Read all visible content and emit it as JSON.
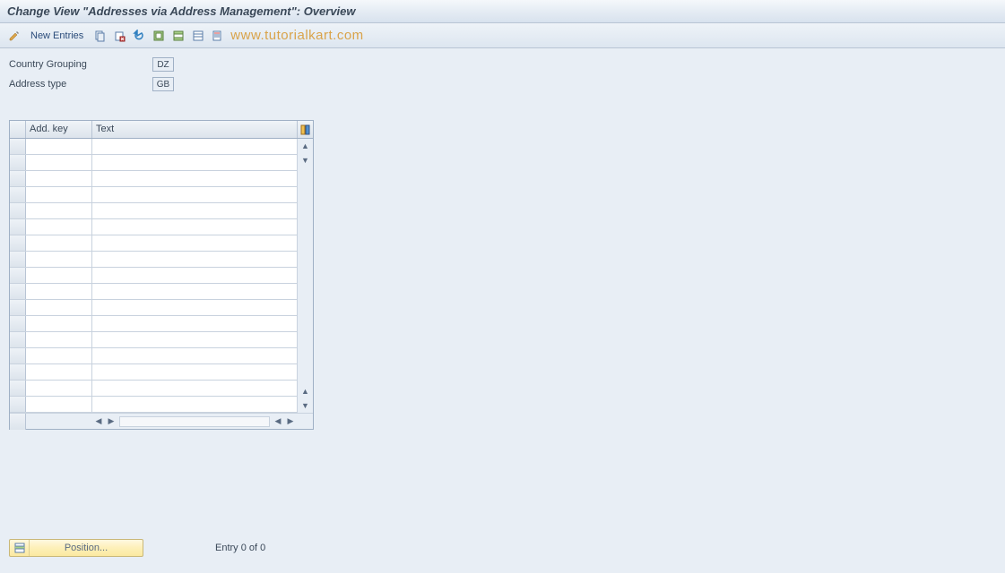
{
  "title": "Change View \"Addresses via Address Management\": Overview",
  "toolbar": {
    "new_entries_label": "New Entries"
  },
  "watermark": "www.tutorialkart.com",
  "fields": {
    "country_grouping": {
      "label": "Country Grouping",
      "value": "DZ"
    },
    "address_type": {
      "label": "Address type",
      "value": "GB"
    }
  },
  "table": {
    "columns": {
      "key": "Add. key",
      "text": "Text"
    },
    "row_count": 17
  },
  "footer": {
    "position_label": "Position...",
    "entry_status": "Entry 0 of 0"
  }
}
